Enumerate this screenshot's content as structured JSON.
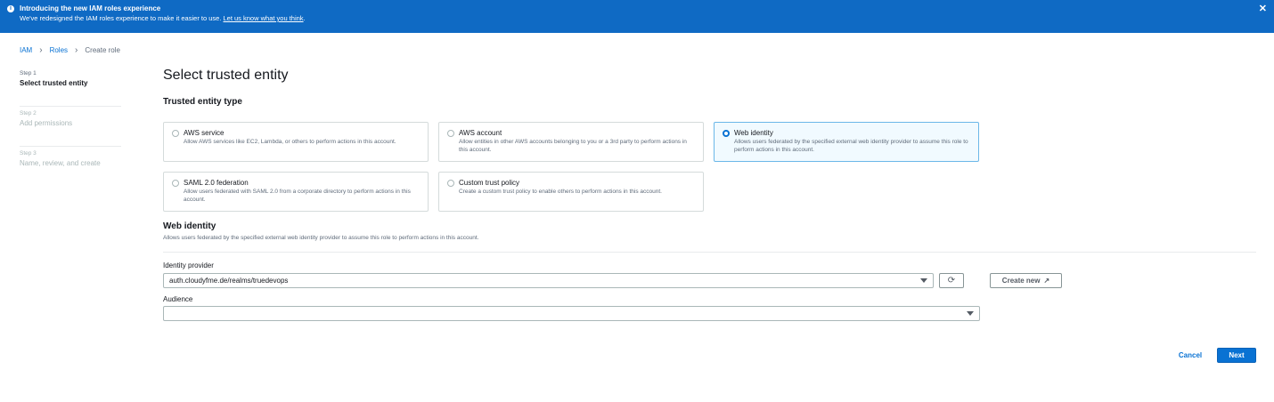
{
  "banner": {
    "title": "Introducing the new IAM roles experience",
    "message": "We've redesigned the IAM roles experience to make it easier to use. ",
    "link": "Let us know what you think",
    "after_link": ".",
    "icon": "info-icon",
    "close_icon": "close-icon",
    "bg_color": "#0f6ac4"
  },
  "breadcrumb": {
    "items": [
      "IAM",
      "Roles"
    ],
    "current": "Create role"
  },
  "steps": [
    {
      "label": "Step 1",
      "name": "Select trusted entity"
    },
    {
      "label": "Step 2",
      "name": "Add permissions"
    },
    {
      "label": "Step 3",
      "name": "Name, review, and create"
    }
  ],
  "page_title": "Select trusted entity",
  "trusted_entity_type": {
    "heading": "Trusted entity type",
    "options": [
      {
        "title": "AWS service",
        "desc": "Allow AWS services like EC2, Lambda, or others to perform actions in this account.",
        "selected": false
      },
      {
        "title": "AWS account",
        "desc": "Allow entities in other AWS accounts belonging to you or a 3rd party to perform actions in this account.",
        "selected": false
      },
      {
        "title": "Web identity",
        "desc": "Allows users federated by the specified external web identity provider to assume this role to perform actions in this account.",
        "selected": true
      },
      {
        "title": "SAML 2.0 federation",
        "desc": "Allow users federated with SAML 2.0 from a corporate directory to perform actions in this account.",
        "selected": false
      },
      {
        "title": "Custom trust policy",
        "desc": "Create a custom trust policy to enable others to perform actions in this account.",
        "selected": false
      }
    ]
  },
  "web_identity": {
    "heading": "Web identity",
    "desc": "Allows users federated by the specified external web identity provider to assume this role to perform actions in this account.",
    "identity_provider_label": "Identity provider",
    "identity_provider_value": "auth.cloudyfme.de/realms/truedevops",
    "audience_label": "Audience",
    "audience_value": "",
    "refresh_icon": "refresh-icon",
    "create_new_label": "Create new",
    "external_icon": "external-link-icon"
  },
  "footer": {
    "cancel_label": "Cancel",
    "next_label": "Next",
    "accent_color": "#0972d3"
  }
}
